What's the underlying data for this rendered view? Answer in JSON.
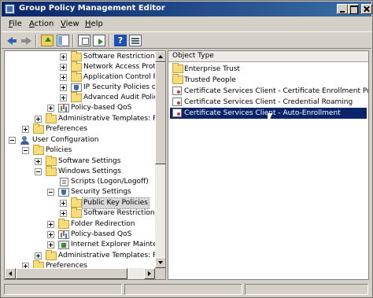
{
  "window": {
    "title": "Group Policy Management Editor"
  },
  "menu": [
    {
      "label": "File",
      "underline": "F",
      "rest": "ile"
    },
    {
      "label": "Action",
      "underline": "A",
      "rest": "ction"
    },
    {
      "label": "View",
      "underline": "V",
      "rest": "iew"
    },
    {
      "label": "Help",
      "underline": "H",
      "rest": "elp"
    }
  ],
  "toolbar": {
    "icons": [
      "back-arrow-icon",
      "forward-arrow-icon",
      "up-folder-icon",
      "show-hide-tree-icon",
      "copy-icon",
      "export-list-icon",
      "help-icon",
      "properties-icon"
    ],
    "help_glyph": "?"
  },
  "tree": {
    "items": [
      {
        "label": "Software Restriction Po",
        "icon": "folder"
      },
      {
        "label": "Network Access Protect",
        "icon": "folder"
      },
      {
        "label": "Application Control Poli",
        "icon": "folder"
      },
      {
        "label": "IP Security Policies on A",
        "icon": "shield"
      },
      {
        "label": "Advanced Audit Policy",
        "icon": "folder"
      },
      {
        "label": "Policy-based QoS",
        "icon": "chart"
      },
      {
        "label": "Administrative Templates: Polic",
        "icon": "folder"
      },
      {
        "label": "Preferences",
        "icon": "folder"
      },
      {
        "label": "User Configuration",
        "icon": "user"
      },
      {
        "label": "Policies",
        "icon": "folder"
      },
      {
        "label": "Software Settings",
        "icon": "folder"
      },
      {
        "label": "Windows Settings",
        "icon": "folder"
      },
      {
        "label": "Scripts (Logon/Logoff)",
        "icon": "doc"
      },
      {
        "label": "Security Settings",
        "icon": "shield"
      },
      {
        "label": "Public Key Policies",
        "icon": "folder",
        "selected": true
      },
      {
        "label": "Software Restriction Po",
        "icon": "folder"
      },
      {
        "label": "Folder Redirection",
        "icon": "folder"
      },
      {
        "label": "Policy-based QoS",
        "icon": "chart"
      },
      {
        "label": "Internet Explorer Maintena",
        "icon": "gpo"
      },
      {
        "label": "Administrative Templates: Polic",
        "icon": "folder"
      },
      {
        "label": "Preferences",
        "icon": "folder"
      }
    ]
  },
  "list": {
    "column_header": "Object Type",
    "items": [
      {
        "label": "Enterprise Trust",
        "icon": "folder"
      },
      {
        "label": "Trusted People",
        "icon": "folder"
      },
      {
        "label": "Certificate Services Client - Certificate Enrollment Policy",
        "icon": "cert"
      },
      {
        "label": "Certificate Services Client - Credential Roaming",
        "icon": "cert"
      },
      {
        "label": "Certificate Services Client - Auto-Enrollment",
        "icon": "cert",
        "selected": true
      }
    ]
  },
  "colors": {
    "title_bar_start": "#0a246a",
    "title_bar_end": "#3a6ea5",
    "selection": "#0a246a"
  }
}
